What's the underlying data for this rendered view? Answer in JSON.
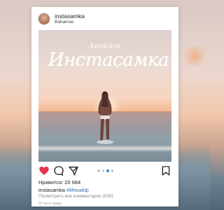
{
  "post": {
    "username": "instasamka",
    "location": "Bahamas",
    "overlay_name": "Anokhin",
    "overlay_title": "Инстасамка",
    "likes_text": "Нравится: 20 684",
    "caption_user": "instasamka",
    "caption_tag": "#lifeкайф",
    "comments_link": "Посмотреть все комментарии (838)",
    "time_ago": "23 часа назад"
  },
  "carousel": {
    "count": 4,
    "active_index": 2
  },
  "icons": [
    "heart-icon",
    "comment-icon",
    "share-icon",
    "bookmark-icon"
  ],
  "colors": {
    "like": "#e8334a",
    "tag": "#3f6fa8",
    "active_dot": "#3a8fe0"
  }
}
